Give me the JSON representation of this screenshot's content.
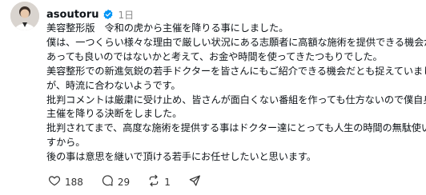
{
  "post": {
    "username": "asoutoru",
    "timestamp": "1日",
    "lines": [
      "美容整形版　令和の虎から主催を降りる事にしました。",
      "僕は、一つくらい様々な理由で厳しい状況にある志願者に高額な施術を提供できる機会が",
      "あっても良いのではないかと考えて、お金や時間を使ってきたつもりでした。",
      "美容整形での新進気鋭の若手ドクターを皆さんにもご紹介できる機会だとも捉えていました",
      "が、時流に合わないようです。",
      "批判コメントは厳粛に受け止め、皆さんが面白くない番組を作っても仕方ないので僕自身は",
      "主催を降りる決断をしました。",
      "批判されてまで、高度な施術を提供する事はドクター達にとっても人生の時間の無駄使いで",
      "すから。",
      "後の事は意思を継いで頂ける若手にお任せしたいと思います。"
    ]
  },
  "actions": {
    "likes": "188",
    "comments": "29",
    "reposts": "1"
  },
  "icons": {
    "avatar": "avatar",
    "verified": "verified-badge-icon",
    "like": "heart-icon",
    "comment": "comment-icon",
    "repost": "repost-icon",
    "share": "share-icon"
  },
  "colors": {
    "verified": "#0095f6",
    "text": "#0f1419",
    "muted": "#8a8a8a"
  }
}
